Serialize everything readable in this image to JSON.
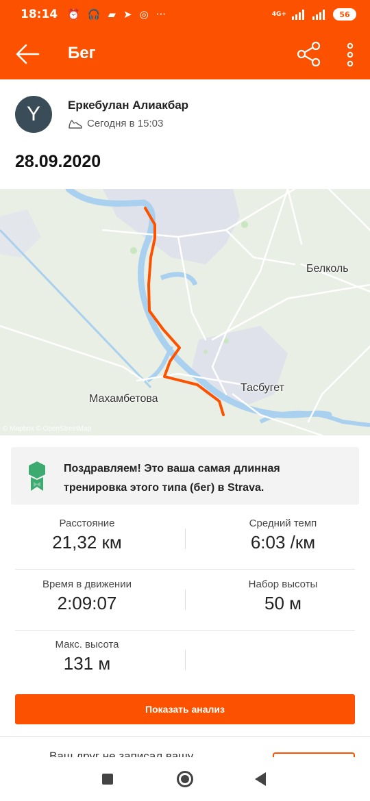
{
  "status_bar": {
    "time": "18:14",
    "icons": [
      "alarm-icon",
      "headphones-icon",
      "message-icon",
      "telegram-icon",
      "instagram-icon",
      "more-dots-icon"
    ],
    "network_label": "4G+",
    "battery": "56"
  },
  "app_bar": {
    "title": "Бег",
    "icons": [
      "back-arrow-icon",
      "share-icon",
      "more-vertical-icon"
    ]
  },
  "athlete": {
    "avatar_letter": "Y",
    "name": "Еркебулан Алиакбар",
    "activity_icon": "shoe-icon",
    "timestamp": "Сегодня в 15:03"
  },
  "activity_date": "28.09.2020",
  "map": {
    "labels": {
      "belkol": "Белколь",
      "tasbuget": "Тасбугет",
      "makhambetova": "Махамбетова"
    },
    "attribution": "© Mapbox © OpenStreetMap",
    "route_color": "#fc5200"
  },
  "achievement": {
    "icon": "badge-icon",
    "text": "Поздравляем! Это ваша самая длинная тренировка этого типа (бег) в Strava."
  },
  "stats": {
    "distance": {
      "label": "Расстояние",
      "value": "21,32 км"
    },
    "pace": {
      "label": "Средний темп",
      "value": "6:03 /км"
    },
    "moving_time": {
      "label": "Время в движении",
      "value": "2:09:07"
    },
    "elevation_gain": {
      "label": "Набор высоты",
      "value": "50 м"
    },
    "max_elevation": {
      "label": "Макс. высота",
      "value": "131 м"
    }
  },
  "analysis_button": "Показать анализ",
  "friend_teaser": "Ваш друг не записал вашу",
  "colors": {
    "brand": "#fc5200",
    "avatar_bg": "#3a4c57",
    "badge": "#3dab70"
  }
}
